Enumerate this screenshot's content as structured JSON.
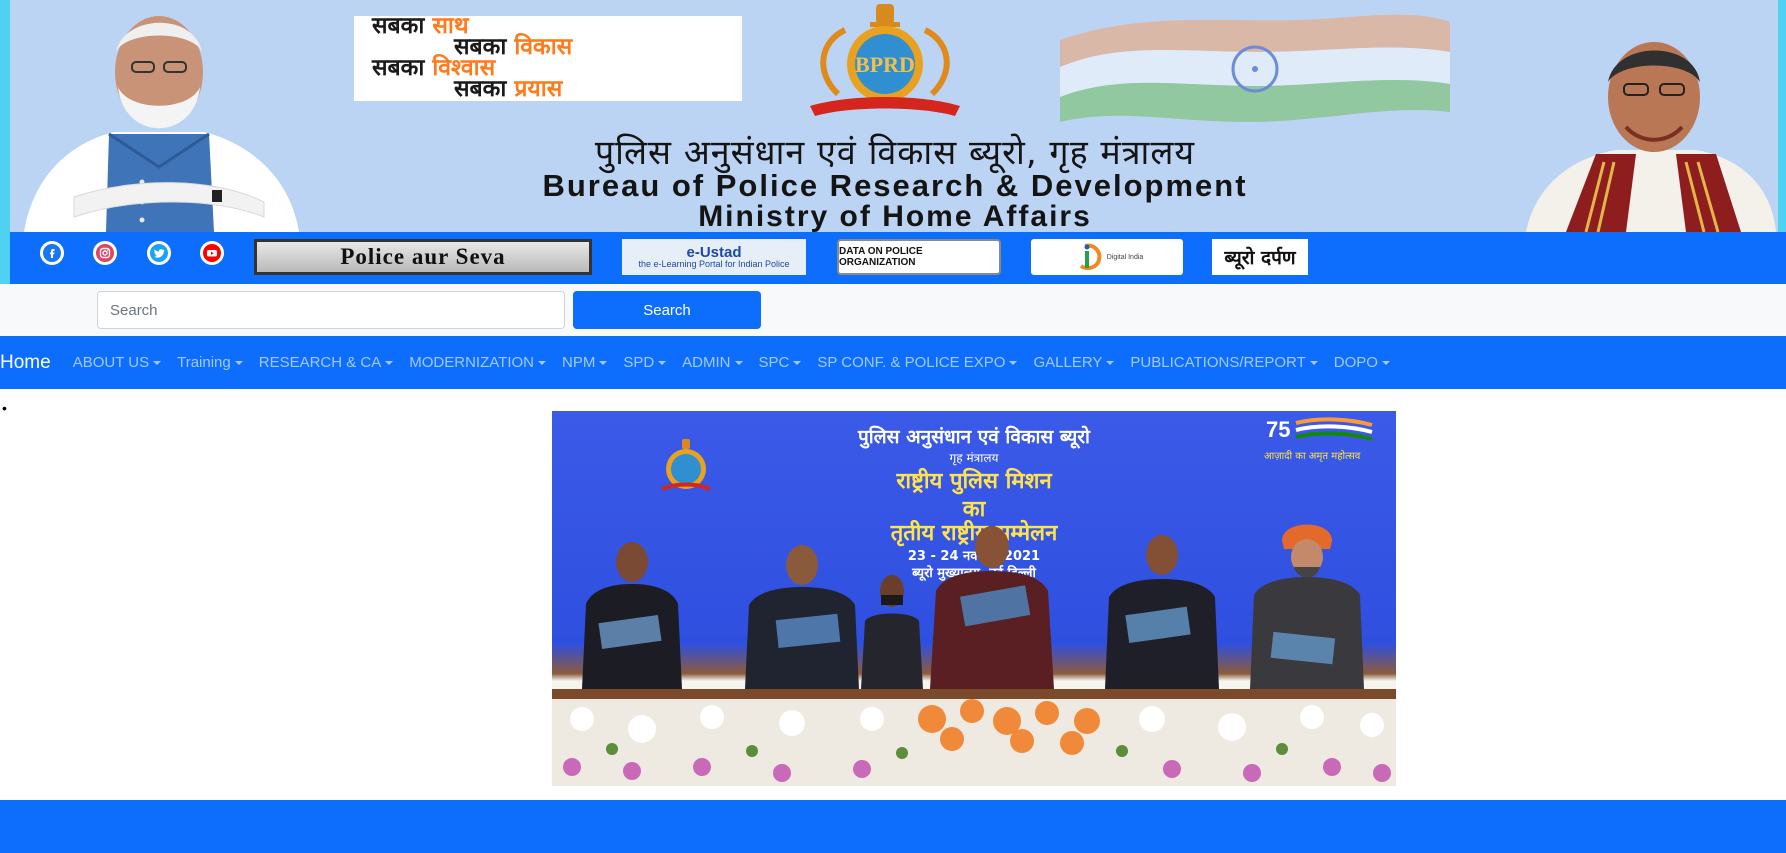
{
  "header": {
    "slogan": {
      "l1a": "सबका ",
      "l1b": "साथ",
      "l2a": "सबका ",
      "l2b": "विकास",
      "l3a": "सबका ",
      "l3b": "विश्वास",
      "l4a": "सबका ",
      "l4b": "प्रयास"
    },
    "emblem_text": "BPRD",
    "title_hindi": "पुलिस अनुसंधान एवं विकास ब्यूरो, गृह मंत्रालय",
    "title_en_line1": "Bureau of Police Research & Development",
    "title_en_line2": "Ministry of Home Affairs"
  },
  "linkbar": {
    "social": [
      {
        "name": "facebook-icon",
        "color": "#1877f2"
      },
      {
        "name": "instagram-icon",
        "color": "#e4405f"
      },
      {
        "name": "twitter-icon",
        "color": "#1da1f2"
      },
      {
        "name": "youtube-icon",
        "color": "#ff0000"
      }
    ],
    "police_aur_seva": "Police aur Seva",
    "eustad_title": "e-Ustad",
    "eustad_sub": "the e-Learning Portal for Indian Police",
    "dopo": "DATA ON POLICE ORGANIZATION",
    "digital_india": "Digital India",
    "bureau_darpan": "ब्यूरो दर्पण"
  },
  "search": {
    "placeholder": "Search",
    "button": "Search"
  },
  "nav": {
    "home": "Home",
    "items": [
      "ABOUT US",
      "Training",
      "RESEARCH & CA",
      "MODERNIZATION",
      "NPM",
      "SPD",
      "ADMIN",
      "SPC",
      "SP CONF. & POLICE EXPO",
      "GALLERY",
      "PUBLICATIONS/REPORT",
      "DOPO"
    ]
  },
  "bullet": "•",
  "photo": {
    "line1": "पुलिस अनुसंधान एवं विकास ब्यूरो",
    "line2": "गृह मंत्रालय",
    "line3": "राष्ट्रीय पुलिस मिशन",
    "line4": "का",
    "line5": "तृतीय राष्ट्रीय सम्मेलन",
    "line6": "23 - 24 नवम्बर, 2021",
    "line7": "ब्यूरो मुख्यालय, नई दिल्ली",
    "azadi": "आज़ादी का अमृत महोत्सव",
    "seventy_five": "75"
  },
  "colors": {
    "primary": "#0d6efd",
    "banner_bg": "#bcd4f4",
    "accent_cyan": "#4fd1f2",
    "saffron": "#ff7a1a"
  }
}
